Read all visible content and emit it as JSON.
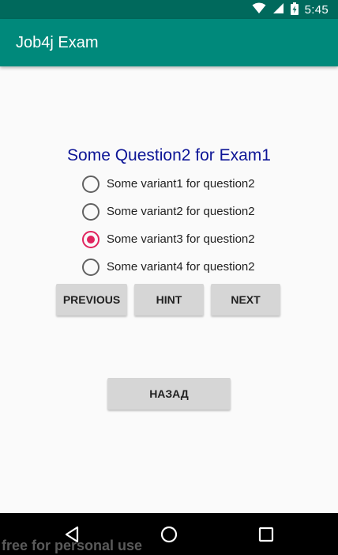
{
  "status_bar": {
    "time": "5:45",
    "icons": [
      "wifi-icon",
      "signal-icon",
      "battery-charging-icon"
    ],
    "color": "#00695c"
  },
  "app_bar": {
    "title": "Job4j Exam",
    "color": "#00897b"
  },
  "question": {
    "title": "Some Question2 for Exam1",
    "title_color": "#0d1596",
    "options": [
      {
        "label": "Some variant1 for question2",
        "checked": false
      },
      {
        "label": "Some variant2 for question2",
        "checked": false
      },
      {
        "label": "Some variant3 for question2",
        "checked": true
      },
      {
        "label": "Some variant4 for question2",
        "checked": false
      }
    ],
    "selected_color": "#e0245e"
  },
  "buttons": {
    "previous": "PREVIOUS",
    "hint": "HINT",
    "next": "NEXT",
    "back": "НАЗАД"
  },
  "nav_bar": {
    "icons": [
      "back-triangle-icon",
      "home-circle-icon",
      "recents-square-icon"
    ]
  },
  "watermark": "free for personal use"
}
